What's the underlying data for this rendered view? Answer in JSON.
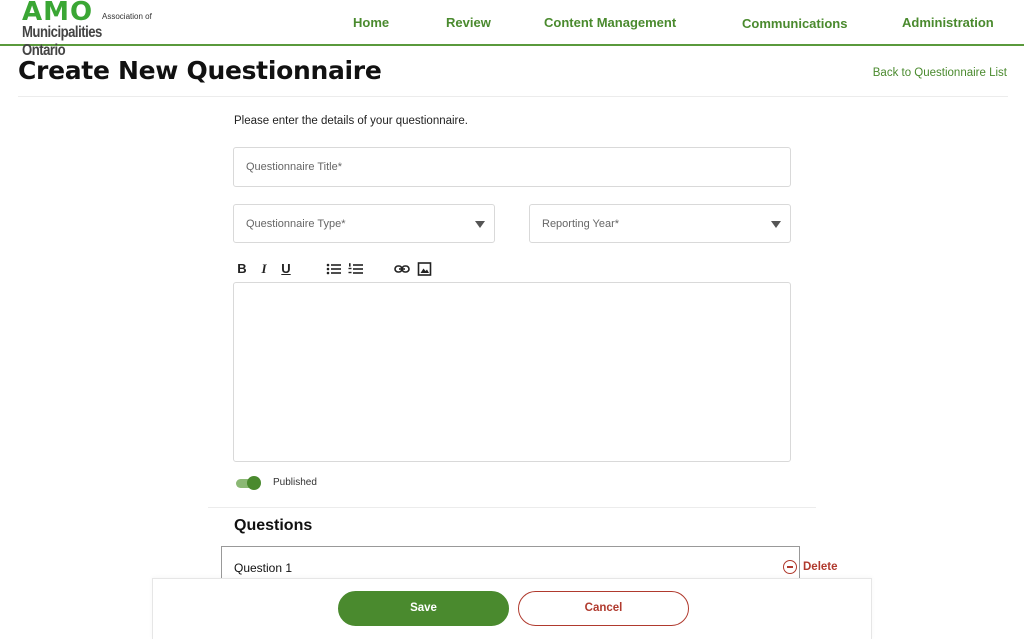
{
  "brand": {
    "logo_mark": "AMO",
    "logo_assoc": "Association of",
    "logo_name": "Municipalities Ontario"
  },
  "nav": {
    "items": [
      "Home",
      "Review",
      "Content Management",
      "Communications",
      "Administration"
    ]
  },
  "page": {
    "title": "Create New Questionnaire",
    "back_link": "Back to Questionnaire List"
  },
  "form": {
    "intro": "Please enter the details of your questionnaire.",
    "title_placeholder": "Questionnaire Title*",
    "type_placeholder": "Questionnaire Type*",
    "year_placeholder": "Reporting Year*",
    "toolbar": {
      "bold": "B",
      "italic": "I",
      "underline": "U"
    },
    "published_label": "Published",
    "published": true
  },
  "questions": {
    "heading": "Questions",
    "items": [
      {
        "label": "Question 1",
        "delete_label": "Delete"
      }
    ]
  },
  "actions": {
    "save": "Save",
    "cancel": "Cancel"
  },
  "colors": {
    "brand_green": "#4a8a2e",
    "logo_green": "#3aa634",
    "danger_red": "#b03a2e"
  }
}
